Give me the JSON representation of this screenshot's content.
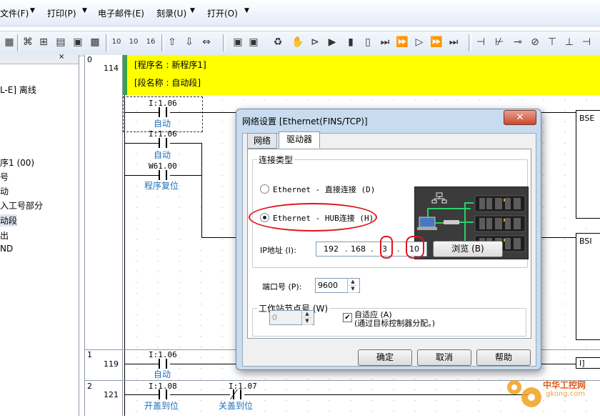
{
  "menubar": {
    "items": [
      {
        "label": "文件(F)"
      },
      {
        "label": "打印(P)"
      },
      {
        "label": "电子邮件(E)"
      },
      {
        "label": "刻录(U)"
      },
      {
        "label": "打开(O)"
      }
    ]
  },
  "tree": {
    "items": [
      "L-E] 离线",
      "序1 (00)",
      "号",
      "动",
      "入工号部分",
      "动段",
      "出",
      "ND"
    ]
  },
  "ladder": {
    "rung0": {
      "num": "0",
      "addr": "114",
      "program_name": "[程序名 : 新程序1]",
      "section_name": "[段名称 : 自动段]"
    },
    "contacts": [
      {
        "addr": "I:1.06",
        "comment": "自动"
      },
      {
        "addr": "I:1.06",
        "comment": "自动"
      },
      {
        "addr": "W61.00",
        "comment": "程序复位"
      }
    ],
    "rung1": {
      "num": "1",
      "addr": "119",
      "contact_addr": "I:1.06",
      "comment": "自动"
    },
    "rung2": {
      "num": "2",
      "addr": "121",
      "contact1_addr": "I:1.08",
      "comment1": "开盖到位",
      "contact2_addr": "I:1.07",
      "comment2": "关盖到位"
    },
    "bsr_label": "BSE",
    "bsr2_label": "BSI",
    "right_label": "I]"
  },
  "dialog": {
    "title": "网络设置 [Ethernet(FINS/TCP)]",
    "close": "✕",
    "tabs": [
      "网络",
      "驱动器"
    ],
    "conn_group": "连接类型",
    "radio_direct": "Ethernet - 直接连接 (D)",
    "radio_hub": "Ethernet - HUB连接 (H)",
    "ip_label": "IP地址 (I):",
    "ip": [
      "192",
      "168",
      "3",
      "10"
    ],
    "browse": "浏览 (B)",
    "port_label": "端口号 (P):",
    "port": "9600",
    "node_group": "工作站节点号 (W)",
    "node_value": "0",
    "auto_label": "自适应 (A)",
    "auto_note": "(通过目标控制器分配。)",
    "ok": "确定",
    "cancel": "取消",
    "help": "帮助"
  },
  "watermark": {
    "site_cn": "中华工控网",
    "site_url": "gkong.com"
  }
}
